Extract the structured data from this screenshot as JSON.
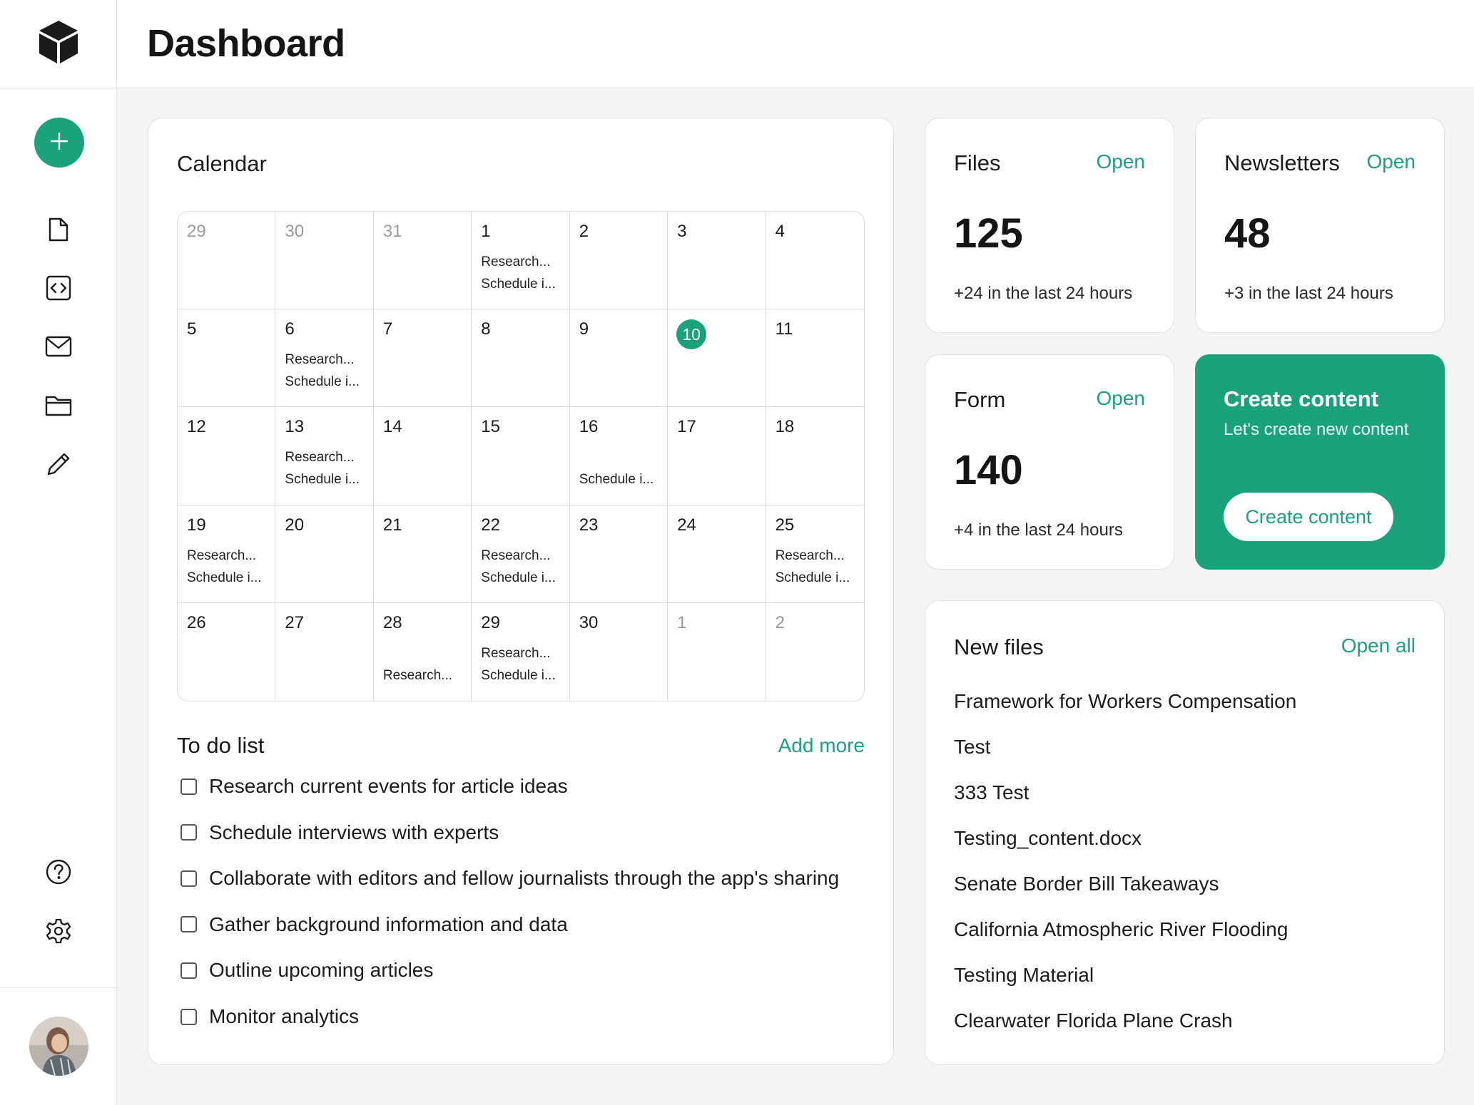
{
  "header": {
    "title": "Dashboard"
  },
  "sidebar": {
    "logo_icon": "cube-logo-icon",
    "new_button_icon": "plus-icon",
    "nav": [
      {
        "icon": "file-icon"
      },
      {
        "icon": "code-icon"
      },
      {
        "icon": "mail-icon"
      },
      {
        "icon": "folder-icon"
      },
      {
        "icon": "pencil-icon"
      }
    ],
    "bottom": [
      {
        "icon": "help-icon"
      },
      {
        "icon": "settings-gear-icon"
      }
    ]
  },
  "calendar": {
    "title": "Calendar",
    "today": "10",
    "days": [
      {
        "day": "29",
        "muted": true,
        "events": []
      },
      {
        "day": "30",
        "muted": true,
        "events": []
      },
      {
        "day": "31",
        "muted": true,
        "events": []
      },
      {
        "day": "1",
        "events": [
          "Research...",
          "Schedule i..."
        ]
      },
      {
        "day": "2",
        "events": []
      },
      {
        "day": "3",
        "events": []
      },
      {
        "day": "4",
        "events": []
      },
      {
        "day": "5",
        "events": []
      },
      {
        "day": "6",
        "events": [
          "Research...",
          "Schedule i..."
        ]
      },
      {
        "day": "7",
        "events": []
      },
      {
        "day": "8",
        "events": []
      },
      {
        "day": "9",
        "events": []
      },
      {
        "day": "10",
        "today": true,
        "events": []
      },
      {
        "day": "11",
        "events": []
      },
      {
        "day": "12",
        "events": []
      },
      {
        "day": "13",
        "events": [
          "Research...",
          "Schedule i..."
        ]
      },
      {
        "day": "14",
        "events": []
      },
      {
        "day": "15",
        "events": []
      },
      {
        "day": "16",
        "events": [
          "",
          "Schedule i..."
        ]
      },
      {
        "day": "17",
        "events": []
      },
      {
        "day": "18",
        "events": []
      },
      {
        "day": "19",
        "events": [
          "Research...",
          "Schedule i..."
        ]
      },
      {
        "day": "20",
        "events": []
      },
      {
        "day": "21",
        "events": []
      },
      {
        "day": "22",
        "events": [
          "Research...",
          "Schedule i..."
        ]
      },
      {
        "day": "23",
        "events": []
      },
      {
        "day": "24",
        "events": []
      },
      {
        "day": "25",
        "events": [
          "Research...",
          "Schedule i..."
        ]
      },
      {
        "day": "26",
        "events": []
      },
      {
        "day": "27",
        "events": []
      },
      {
        "day": "28",
        "events": [
          "",
          "Research..."
        ]
      },
      {
        "day": "29",
        "events": [
          "Research...",
          "Schedule i..."
        ]
      },
      {
        "day": "30",
        "events": []
      },
      {
        "day": "1",
        "muted": true,
        "events": []
      },
      {
        "day": "2",
        "muted": true,
        "events": []
      }
    ]
  },
  "todo": {
    "title": "To do list",
    "add_more": "Add more",
    "items": [
      "Research current events for article ideas",
      "Schedule interviews with experts",
      "Collaborate with editors and fellow journalists through the app's sharing",
      "Gather background information and data",
      "Outline upcoming articles",
      "Monitor analytics"
    ]
  },
  "stats": {
    "files": {
      "title": "Files",
      "open": "Open",
      "value": "125",
      "delta": "+24 in the last 24 hours"
    },
    "newsletters": {
      "title": "Newsletters",
      "open": "Open",
      "value": "48",
      "delta": "+3 in the last 24 hours"
    },
    "form": {
      "title": "Form",
      "open": "Open",
      "value": "140",
      "delta": "+4 in the last 24 hours"
    }
  },
  "create": {
    "title": "Create content",
    "subtitle": "Let's create new content",
    "button": "Create content"
  },
  "new_files": {
    "title": "New files",
    "open_all": "Open all",
    "items": [
      "Framework for Workers Compensation",
      "Test",
      "333 Test",
      "Testing_content.docx",
      "Senate Border Bill Takeaways",
      "California Atmospheric River Flooding",
      "Testing Material",
      "Clearwater Florida Plane Crash"
    ]
  },
  "colors": {
    "accent": "#1aa37a",
    "background": "#f4f4f4",
    "card": "#ffffff"
  }
}
